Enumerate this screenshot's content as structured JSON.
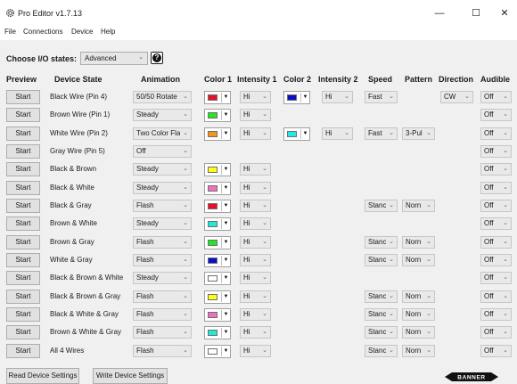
{
  "window": {
    "title": "Pro Editor v1.7.13",
    "minimize_glyph": "—",
    "maximize_glyph": "☐",
    "close_glyph": "✕",
    "icon": "gear-icon"
  },
  "menu": [
    "File",
    "Connections",
    "Device",
    "Help"
  ],
  "io_states": {
    "label": "Choose I/O states:",
    "value": "Advanced",
    "help_glyph": "?"
  },
  "columns": [
    "Preview",
    "Device State",
    "Animation",
    "Color 1",
    "Intensity 1",
    "Color 2",
    "Intensity 2",
    "Speed",
    "Pattern",
    "Direction",
    "Audible"
  ],
  "rows": [
    {
      "preview": "Start",
      "state": "Black Wire (Pin 4)",
      "animation": "50/50 Rotate",
      "color1": "#e81123",
      "intensity1": "Hi",
      "color2": "#0a10c8",
      "intensity2": "Hi",
      "speed": "Fast",
      "pattern": "",
      "direction": "CW",
      "audible": "Off"
    },
    {
      "preview": "Start",
      "state": "Brown Wire (Pin 1)",
      "animation": "Steady",
      "color1": "#22e822",
      "intensity1": "Hi",
      "color2": "",
      "intensity2": "",
      "speed": "",
      "pattern": "",
      "direction": "",
      "audible": "Off"
    },
    {
      "preview": "Start",
      "state": "White Wire (Pin 2)",
      "animation": "Two Color Fla",
      "color1": "#f7941d",
      "intensity1": "Hi",
      "color2": "#22e8e8",
      "intensity2": "Hi",
      "speed": "Fast",
      "pattern": "3-Pul",
      "direction": "",
      "audible": "Off"
    },
    {
      "preview": "Start",
      "state": "Gray Wire (Pin 5)",
      "animation": "Off",
      "color1": "",
      "intensity1": "",
      "color2": "",
      "intensity2": "",
      "speed": "",
      "pattern": "",
      "direction": "",
      "audible": "Off"
    },
    {
      "preview": "Start",
      "state": "Black & Brown",
      "animation": "Steady",
      "color1": "#ffff1a",
      "intensity1": "Hi",
      "color2": "",
      "intensity2": "",
      "speed": "",
      "pattern": "",
      "direction": "",
      "audible": "Off"
    },
    {
      "preview": "Start",
      "state": "Black & White",
      "animation": "Steady",
      "color1": "#f26fc0",
      "intensity1": "Hi",
      "color2": "",
      "intensity2": "",
      "speed": "",
      "pattern": "",
      "direction": "",
      "audible": "Off"
    },
    {
      "preview": "Start",
      "state": "Black & Gray",
      "animation": "Flash",
      "color1": "#e81123",
      "intensity1": "Hi",
      "color2": "",
      "intensity2": "",
      "speed": "Stanc",
      "pattern": "Norn",
      "direction": "",
      "audible": "Off"
    },
    {
      "preview": "Start",
      "state": "Brown & White",
      "animation": "Steady",
      "color1": "#22e8d8",
      "intensity1": "Hi",
      "color2": "",
      "intensity2": "",
      "speed": "",
      "pattern": "",
      "direction": "",
      "audible": "Off"
    },
    {
      "preview": "Start",
      "state": "Brown & Gray",
      "animation": "Flash",
      "color1": "#22e822",
      "intensity1": "Hi",
      "color2": "",
      "intensity2": "",
      "speed": "Stanc",
      "pattern": "Norn",
      "direction": "",
      "audible": "Off"
    },
    {
      "preview": "Start",
      "state": "White & Gray",
      "animation": "Flash",
      "color1": "#0a10c8",
      "intensity1": "Hi",
      "color2": "",
      "intensity2": "",
      "speed": "Stanc",
      "pattern": "Norn",
      "direction": "",
      "audible": "Off"
    },
    {
      "preview": "Start",
      "state": "Black & Brown & White",
      "animation": "Steady",
      "color1": "#ffffff",
      "intensity1": "Hi",
      "color2": "",
      "intensity2": "",
      "speed": "",
      "pattern": "",
      "direction": "",
      "audible": "Off"
    },
    {
      "preview": "Start",
      "state": "Black & Brown & Gray",
      "animation": "Flash",
      "color1": "#ffff1a",
      "intensity1": "Hi",
      "color2": "",
      "intensity2": "",
      "speed": "Stanc",
      "pattern": "Norn",
      "direction": "",
      "audible": "Off"
    },
    {
      "preview": "Start",
      "state": "Black & White & Gray",
      "animation": "Flash",
      "color1": "#f26fc0",
      "intensity1": "Hi",
      "color2": "",
      "intensity2": "",
      "speed": "Stanc",
      "pattern": "Norn",
      "direction": "",
      "audible": "Off"
    },
    {
      "preview": "Start",
      "state": "Brown & White & Gray",
      "animation": "Flash",
      "color1": "#22e8d8",
      "intensity1": "Hi",
      "color2": "",
      "intensity2": "",
      "speed": "Stanc",
      "pattern": "Norn",
      "direction": "",
      "audible": "Off"
    },
    {
      "preview": "Start",
      "state": "All 4 Wires",
      "animation": "Flash",
      "color1": "#ffffff",
      "intensity1": "Hi",
      "color2": "",
      "intensity2": "",
      "speed": "Stanc",
      "pattern": "Norn",
      "direction": "",
      "audible": "Off"
    }
  ],
  "footer": {
    "read_label": "Read Device Settings",
    "write_label": "Write Device Settings",
    "logo_text": "BANNER"
  },
  "colors": {
    "background": "#f0f0f0",
    "titlebar": "#ffffff",
    "button": "#e1e1e1",
    "dropdown": "#e9e9e9"
  }
}
